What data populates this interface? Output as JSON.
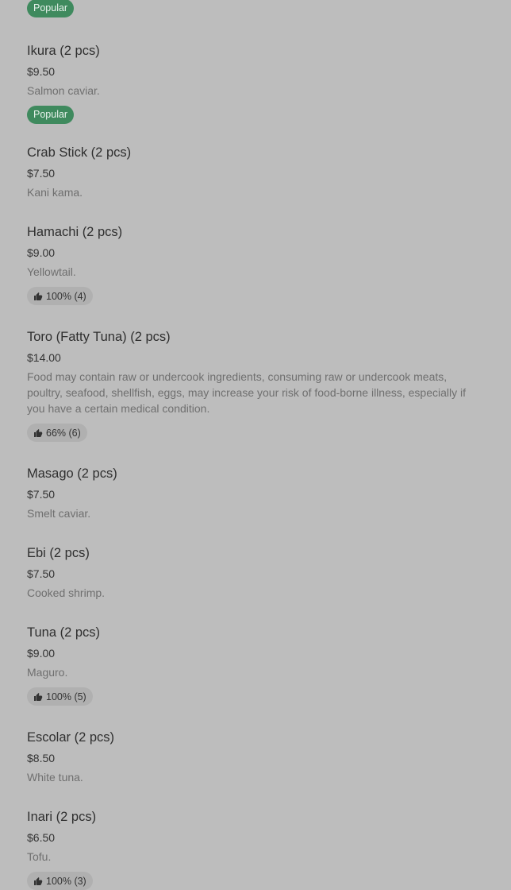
{
  "badges": {
    "popular": "Popular"
  },
  "items": [
    {
      "name": "Ikura (2 pcs)",
      "price": "$9.50",
      "description": "Salmon caviar.",
      "badge": "Popular"
    },
    {
      "name": "Crab Stick (2 pcs)",
      "price": "$7.50",
      "description": "Kani kama."
    },
    {
      "name": "Hamachi (2 pcs)",
      "price": "$9.00",
      "description": "Yellowtail.",
      "rating": "100% (4)"
    },
    {
      "name": "Toro (Fatty Tuna) (2 pcs)",
      "price": "$14.00",
      "description": "Food may contain raw or undercook ingredients, consuming raw or undercook meats, poultry, seafood, shellfish, eggs, may increase your risk of food-borne illness, especially if you have a certain medical condition.",
      "rating": "66% (6)"
    },
    {
      "name": "Masago (2 pcs)",
      "price": "$7.50",
      "description": "Smelt caviar."
    },
    {
      "name": "Ebi (2 pcs)",
      "price": "$7.50",
      "description": "Cooked shrimp."
    },
    {
      "name": "Tuna (2 pcs)",
      "price": "$9.00",
      "description": "Maguro.",
      "rating": "100% (5)"
    },
    {
      "name": "Escolar (2 pcs)",
      "price": "$8.50",
      "description": "White tuna."
    },
    {
      "name": "Inari (2 pcs)",
      "price": "$6.50",
      "description": "Tofu.",
      "rating": "100% (3)"
    }
  ]
}
